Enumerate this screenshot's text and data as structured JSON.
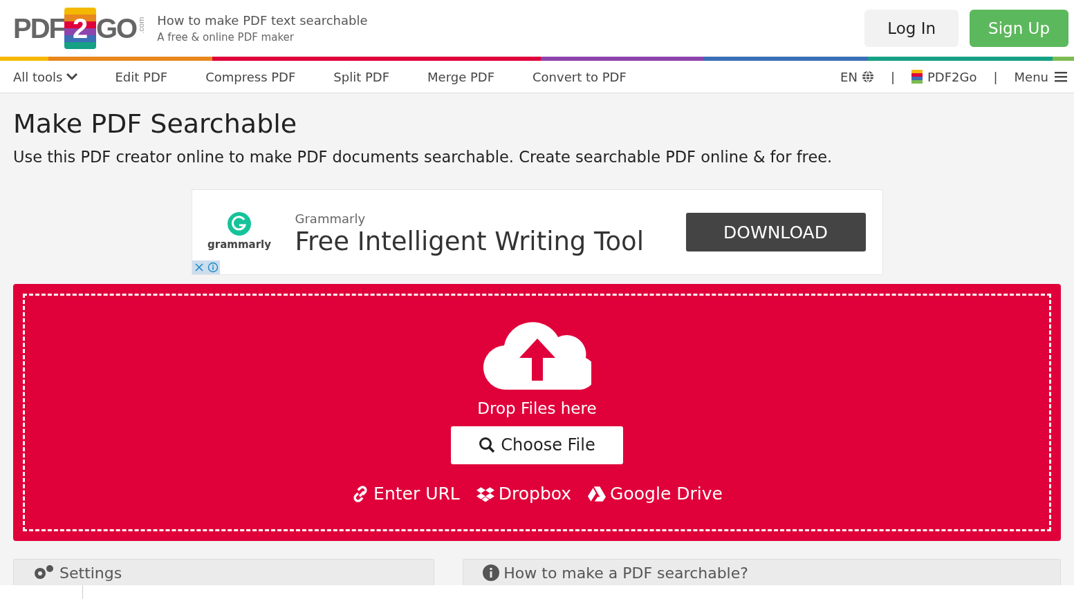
{
  "logo": {
    "left": "PDF",
    "mid": "2",
    "right": "GO",
    "suffix": ".com"
  },
  "header": {
    "title": "How to make PDF text searchable",
    "subtitle": "A free & online PDF maker"
  },
  "auth_buttons": [
    {
      "label": "Log In",
      "kind": "secondary"
    },
    {
      "label": "Sign Up",
      "kind": "primary"
    }
  ],
  "nav": [
    {
      "label": "All tools",
      "dropdown": true
    },
    {
      "label": "Edit PDF",
      "dropdown": false
    },
    {
      "label": "Compress PDF",
      "dropdown": false
    },
    {
      "label": "Split PDF",
      "dropdown": false
    },
    {
      "label": "Merge PDF",
      "dropdown": false
    },
    {
      "label": "Convert to PDF",
      "dropdown": false
    }
  ],
  "nav_right": {
    "language": "EN",
    "separator": "|",
    "brand": "PDF2Go",
    "menu": "Menu"
  },
  "page": {
    "title": "Make PDF Searchable",
    "description": "Use this PDF creator online to make PDF documents searchable. Create searchable PDF online & for free."
  },
  "ad": {
    "logo_text": "grammarly",
    "advertiser": "Grammarly",
    "headline": "Free Intelligent Writing Tool",
    "button": "DOWNLOAD"
  },
  "upload": {
    "drop_text": "Drop Files here",
    "choose_button": "Choose File",
    "sources": [
      {
        "label": "Enter URL",
        "kind": "link"
      },
      {
        "label": "Dropbox",
        "kind": "dropbox"
      },
      {
        "label": "Google Drive",
        "kind": "drive"
      }
    ]
  },
  "panels": [
    {
      "title": "Settings",
      "kind": "settings"
    },
    {
      "title": "How to make a PDF searchable?",
      "kind": "info"
    }
  ]
}
